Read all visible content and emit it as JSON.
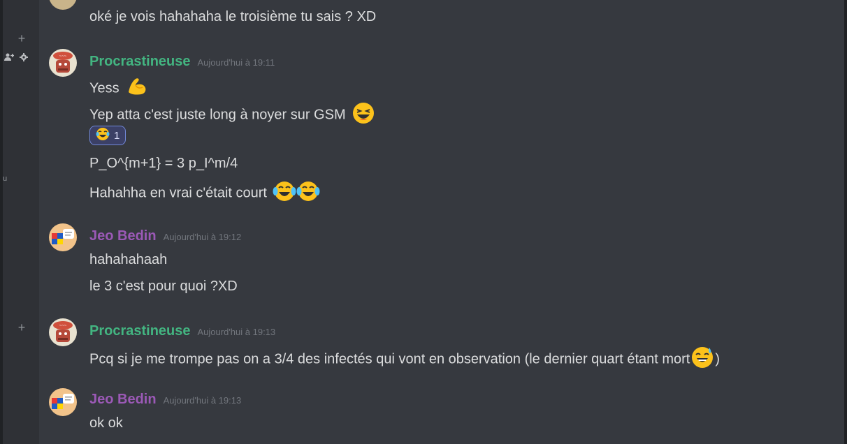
{
  "sidebar": {
    "fragment_text": "u"
  },
  "messages": {
    "m0": {
      "text": "oké je vois hahahaha le troisième tu sais ? XD"
    },
    "g1": {
      "author": "Procrastineuse",
      "timestamp": "Aujourd'hui à 19:11",
      "lines": [
        "Yess",
        "Yep atta c'est juste long à noyer sur GSM",
        "P_O^{m+1} = 3 p_I^m/4",
        "Hahahha en vrai c'était court"
      ],
      "reaction": {
        "emoji": "joy",
        "count": "1"
      }
    },
    "g2": {
      "author": "Jeo Bedin",
      "timestamp": "Aujourd'hui à 19:12",
      "lines": [
        "hahahahaah",
        "le 3 c'est pour quoi ?XD"
      ]
    },
    "g3": {
      "author": "Procrastineuse",
      "timestamp": "Aujourd'hui à 19:13",
      "lines": [
        "Pcq si je me trompe pas on a 3/4 des infectés qui vont en observation (le dernier quart étant mort",
        ")"
      ]
    },
    "g4": {
      "author": "Jeo Bedin",
      "timestamp": "Aujourd'hui à 19:13",
      "lines": [
        "ok ok"
      ]
    }
  },
  "colors": {
    "background": "#36393f",
    "sidebar": "#2f3136",
    "procrastineuse": "#43b581",
    "jeo": "#9b59b6",
    "timestamp": "#72767d",
    "reaction_bg": "#3b4066",
    "reaction_border": "#7289da"
  }
}
